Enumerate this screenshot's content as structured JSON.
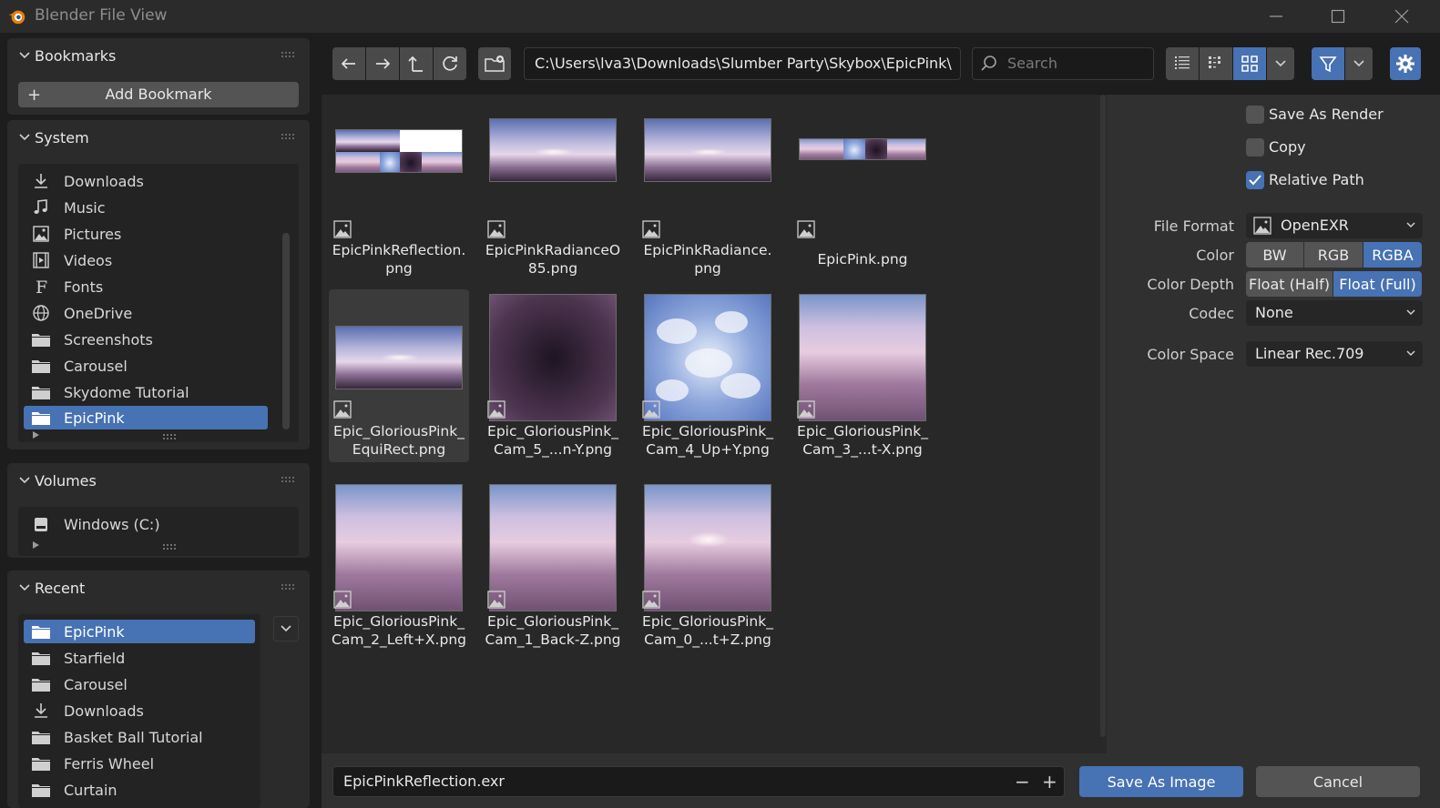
{
  "window": {
    "title": "Blender File View",
    "icons": [
      "blender-logo",
      "minimize-icon",
      "maximize-icon",
      "close-icon"
    ]
  },
  "bookmarks": {
    "title": "Bookmarks",
    "add_label": "Add Bookmark"
  },
  "system": {
    "title": "System",
    "items": [
      {
        "label": "Downloads",
        "icon": "download-icon"
      },
      {
        "label": "Music",
        "icon": "music-icon"
      },
      {
        "label": "Pictures",
        "icon": "image-icon"
      },
      {
        "label": "Videos",
        "icon": "film-icon"
      },
      {
        "label": "Fonts",
        "icon": "font-icon"
      },
      {
        "label": "OneDrive",
        "icon": "globe-icon"
      },
      {
        "label": "Screenshots",
        "icon": "folder-icon"
      },
      {
        "label": "Carousel",
        "icon": "folder-icon"
      },
      {
        "label": "Skydome Tutorial",
        "icon": "folder-icon"
      },
      {
        "label": "EpicPink",
        "icon": "folder-icon",
        "selected": true
      }
    ]
  },
  "volumes": {
    "title": "Volumes",
    "items": [
      {
        "label": "Windows (C:)",
        "icon": "disk-icon"
      }
    ]
  },
  "recent": {
    "title": "Recent",
    "items": [
      {
        "label": "EpicPink",
        "icon": "folder-icon",
        "selected": true
      },
      {
        "label": "Starfield",
        "icon": "folder-icon"
      },
      {
        "label": "Carousel",
        "icon": "folder-icon"
      },
      {
        "label": "Downloads",
        "icon": "download-icon"
      },
      {
        "label": "Basket Ball Tutorial",
        "icon": "folder-icon"
      },
      {
        "label": "Ferris Wheel",
        "icon": "folder-icon"
      },
      {
        "label": "Curtain",
        "icon": "folder-icon"
      }
    ]
  },
  "toolbar": {
    "path": "C:\\Users\\lva3\\Downloads\\Slumber Party\\Skybox\\EpicPink\\",
    "search_placeholder": "Search",
    "icons": [
      "arrow-left-icon",
      "arrow-right-icon",
      "parent-dir-icon",
      "refresh-icon",
      "new-folder-icon",
      "list-vertical-icon",
      "list-horizontal-icon",
      "thumbnails-icon",
      "display-chevron-icon",
      "filter-icon",
      "filter-chevron-icon",
      "settings-gear-icon"
    ]
  },
  "files": [
    {
      "line1": "EpicPinkReflection.",
      "line2": "png",
      "thumb": "strip",
      "selected": false
    },
    {
      "line1": "EpicPinkRadianceO",
      "line2": "85.png",
      "thumb": "wide",
      "selected": false
    },
    {
      "line1": "EpicPinkRadiance.",
      "line2": "png",
      "thumb": "wide",
      "selected": false
    },
    {
      "line1": "EpicPink.png",
      "line2": "",
      "thumb": "strip-thin",
      "selected": false
    },
    {
      "line1": "Epic_GloriousPink_",
      "line2": "EquiRect.png",
      "thumb": "wide",
      "selected": true
    },
    {
      "line1": "Epic_GloriousPink_",
      "line2": "Cam_5_...n-Y.png",
      "thumb": "dark",
      "selected": false
    },
    {
      "line1": "Epic_GloriousPink_",
      "line2": "Cam_4_Up+Y.png",
      "thumb": "clouds-up",
      "selected": false
    },
    {
      "line1": "Epic_GloriousPink_",
      "line2": "Cam_3_...t-X.png",
      "thumb": "side",
      "selected": false
    },
    {
      "line1": "Epic_GloriousPink_",
      "line2": "Cam_2_Left+X.png",
      "thumb": "side",
      "selected": false
    },
    {
      "line1": "Epic_GloriousPink_",
      "line2": "Cam_1_Back-Z.png",
      "thumb": "side",
      "selected": false
    },
    {
      "line1": "Epic_GloriousPink_",
      "line2": "Cam_0_...t+Z.png",
      "thumb": "side-sun",
      "selected": false
    }
  ],
  "props": {
    "save_as_render": {
      "label": "Save As Render",
      "checked": false
    },
    "copy": {
      "label": "Copy",
      "checked": false
    },
    "relative_path": {
      "label": "Relative Path",
      "checked": true
    },
    "file_format": {
      "label": "File Format",
      "value": "OpenEXR"
    },
    "color": {
      "label": "Color",
      "options": [
        "BW",
        "RGB",
        "RGBA"
      ],
      "selected": "RGBA"
    },
    "color_depth": {
      "label": "Color Depth",
      "options": [
        "Float (Half)",
        "Float (Full)"
      ],
      "selected": "Float (Full)"
    },
    "codec": {
      "label": "Codec",
      "value": "None"
    },
    "color_space": {
      "label": "Color Space",
      "value": "Linear Rec.709"
    }
  },
  "bottom": {
    "filename": "EpicPinkReflection.exr",
    "save_label": "Save As Image",
    "cancel_label": "Cancel"
  },
  "colors": {
    "accent": "#4772b3",
    "panel": "#2b2b2b",
    "background": "#1d1d1d"
  }
}
